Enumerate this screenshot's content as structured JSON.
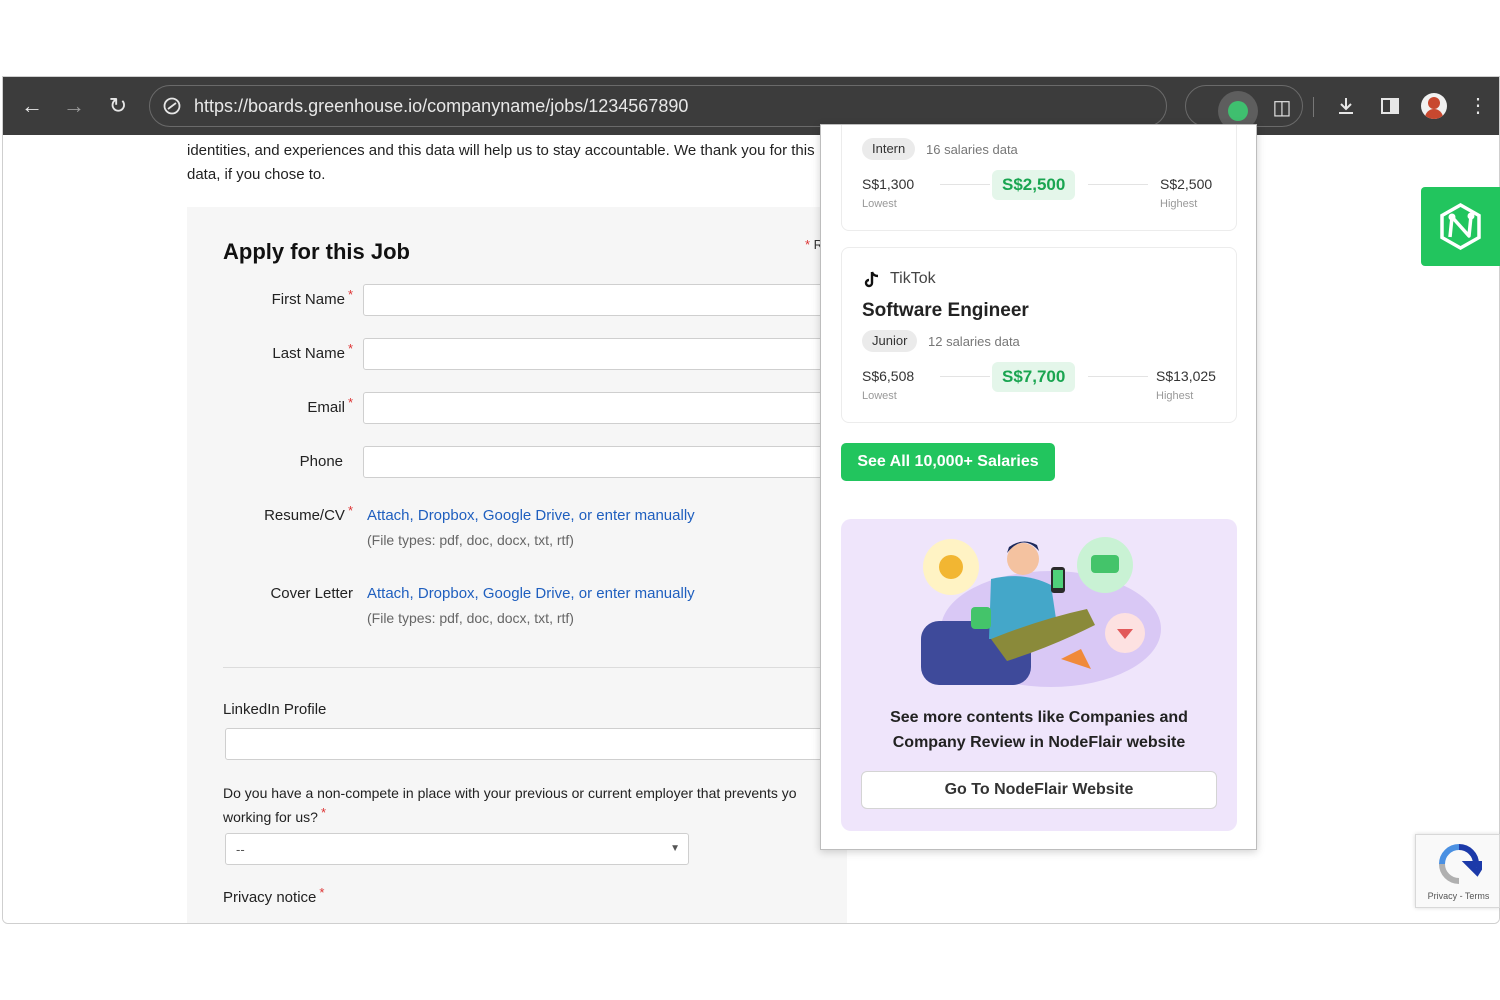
{
  "browser": {
    "url": "https://boards.greenhouse.io/companyname/jobs/1234567890"
  },
  "page": {
    "intro_text": "identities, and experiences and this data will help us to stay accountable. We thank you for this data, if you chose to.",
    "form_title": "Apply for this Job",
    "required_mark": "* ",
    "required_note": "R",
    "fields": {
      "first_name": "First Name",
      "last_name": "Last Name",
      "email": "Email",
      "phone": "Phone",
      "resume": "Resume/CV",
      "cover_letter": "Cover Letter",
      "linkedin": "LinkedIn Profile",
      "noncompete": "Do you have a non-compete in place with your previous or current employer that prevents yo working for us?",
      "privacy": "Privacy notice"
    },
    "attach_text": "Attach, Dropbox, Google Drive, or enter manually",
    "file_types": "(File types: pdf, doc, docx, txt, rtf)",
    "select_value": "--"
  },
  "popup": {
    "card1": {
      "level": "Intern",
      "count": "16 salaries data",
      "lowest": "S$1,300",
      "lowest_label": "Lowest",
      "median": "S$2,500",
      "highest": "S$2,500",
      "highest_label": "Highest"
    },
    "card2": {
      "company": "TikTok",
      "role": "Software Engineer",
      "level": "Junior",
      "count": "12 salaries data",
      "lowest": "S$6,508",
      "lowest_label": "Lowest",
      "median": "S$7,700",
      "highest": "S$13,025",
      "highest_label": "Highest"
    },
    "see_all": "See All 10,000+ Salaries",
    "promo_text": "See more contents like Companies and Company Review in NodeFlair website",
    "go_button": "Go To NodeFlair Website"
  },
  "recaptcha": {
    "links": "Privacy - Terms"
  },
  "colors": {
    "toolbar": "#3c3c3c",
    "accent_green": "#22c55e",
    "link_blue": "#1f5fbf",
    "promo_bg": "#efe5fb"
  }
}
